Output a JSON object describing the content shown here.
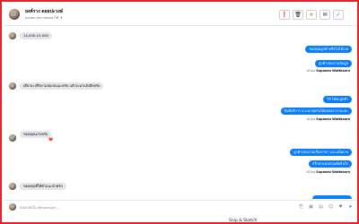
{
  "header": {
    "name": "ยงค์ราง ดอยปะวงษ์",
    "subtitle": "มอบหมายการสนทนาให้",
    "buttons": [
      {
        "icon": "alert-icon",
        "glyph": "❗"
      },
      {
        "icon": "trash-icon",
        "glyph": "🗑"
      },
      {
        "icon": "star-icon",
        "glyph": "★"
      },
      {
        "icon": "inbox-icon",
        "glyph": "✉"
      },
      {
        "icon": "check-icon",
        "glyph": "✓"
      }
    ]
  },
  "messages": [
    {
      "type": "in",
      "text": "14,000-15,000"
    },
    {
      "type": "out",
      "text": "ของคุณลูกค้าหรือไม่ได้เลย"
    },
    {
      "type": "out",
      "text": "ลูกค้าสอบถามข้อมูล"
    },
    {
      "type": "meta",
      "prefix": "ส่งโดย",
      "sender": "Supanan Wattasarn"
    },
    {
      "type": "in",
      "text": "เดี๋ยวจะปรึกษาแฟนก่อนนะครับ แล้วจะมาแจ้งอีกครับ"
    },
    {
      "type": "out",
      "text": "ได้ ได้ค่ะลูกค้า"
    },
    {
      "type": "out",
      "text": "ยินดีบริการ แวะมาคุยกันได้ตลอดเวลานะคะ"
    },
    {
      "type": "meta",
      "prefix": "ส่งโดย",
      "sender": "Supanan Wattasarn"
    },
    {
      "type": "in",
      "text": "ขอบคุณมากครับ",
      "reaction": "❤️"
    },
    {
      "type": "out",
      "text": "ลูกค้าสอบถามเรื่องราคา และแพ็คเกจ"
    },
    {
      "type": "out",
      "text": "ปรึกษาแฟนก่อนตัดสินใจ"
    },
    {
      "type": "meta",
      "prefix": "ส่งโดย",
      "sender": "Supanan Wattasarn"
    },
    {
      "type": "in",
      "text": "ขอบคุณที่ให้คำแนะนำครับ"
    }
  ],
  "composer": {
    "placeholder": "ตอบกลับใน Messenger...",
    "tools": [
      {
        "icon": "attachment-icon",
        "glyph": "⎘"
      },
      {
        "icon": "image-icon",
        "glyph": "▣"
      },
      {
        "icon": "gif-icon",
        "glyph": "▤"
      },
      {
        "icon": "emoji-icon",
        "glyph": "☺"
      },
      {
        "icon": "like-icon",
        "glyph": "♥"
      },
      {
        "icon": "send-icon",
        "glyph": "➤"
      }
    ]
  },
  "taskbar": {
    "tooltip": "Snip & Sketch"
  }
}
